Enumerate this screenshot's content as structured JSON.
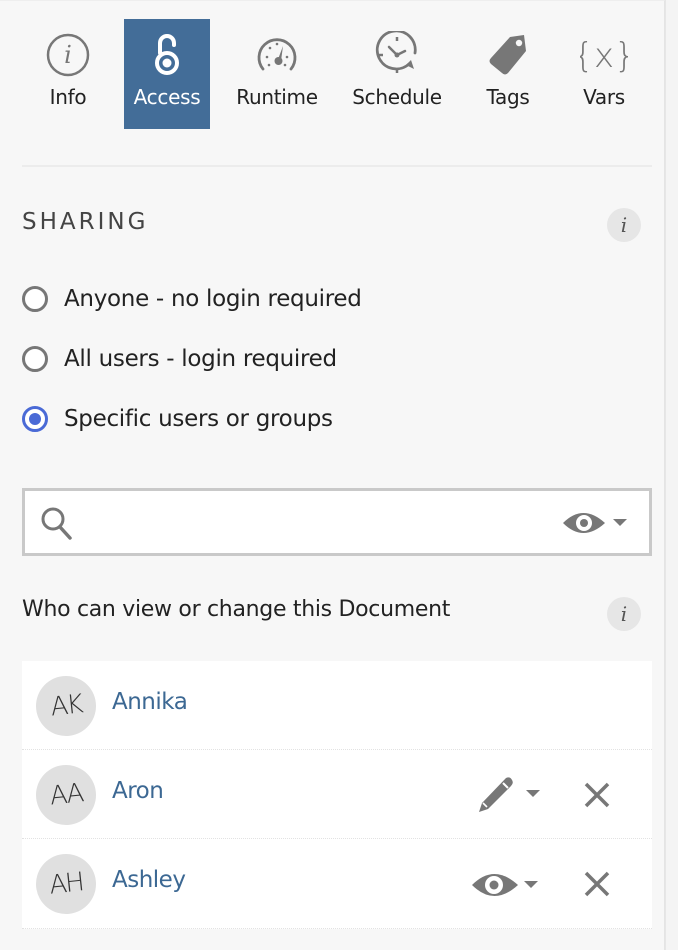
{
  "tabs": [
    {
      "label": "Info",
      "icon": "info-icon",
      "active": false
    },
    {
      "label": "Access",
      "icon": "open-lock-icon",
      "active": true
    },
    {
      "label": "Runtime",
      "icon": "speedometer-icon",
      "active": false
    },
    {
      "label": "Schedule",
      "icon": "clock-refresh-icon",
      "active": false
    },
    {
      "label": "Tags",
      "icon": "tag-icon",
      "active": false
    },
    {
      "label": "Vars",
      "icon": "variable-braces-icon",
      "active": false
    }
  ],
  "sharing": {
    "title": "SHARING",
    "info_glyph": "i",
    "options": [
      {
        "label": "Anyone - no login required",
        "checked": false
      },
      {
        "label": "All users - login required",
        "checked": false
      },
      {
        "label": "Specific users or groups",
        "checked": true
      }
    ]
  },
  "search": {
    "value": "",
    "placeholder": "",
    "permission": "viewer"
  },
  "collaborators": {
    "title": "Who can view or change this Document",
    "info_glyph": "i",
    "users": [
      {
        "initials": "AK",
        "name": "Annika",
        "role": null,
        "removable": false
      },
      {
        "initials": "AA",
        "name": "Aron",
        "role": "editor",
        "removable": true
      },
      {
        "initials": "AH",
        "name": "Ashley",
        "role": "viewer",
        "removable": true
      }
    ]
  },
  "colors": {
    "accent": "#436d98",
    "radio_checked": "#4a6ad6",
    "link": "#3c6893",
    "icon_gray": "#777777"
  }
}
